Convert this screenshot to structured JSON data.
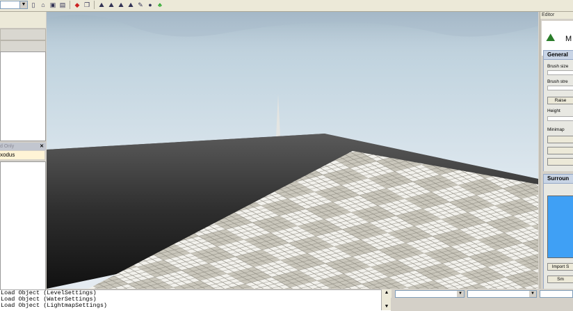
{
  "toolbar": {
    "combo_value": "",
    "icons": [
      "new-file-icon",
      "open-folder-icon",
      "save-icon",
      "save-all-icon",
      "red-tool-icon",
      "copy-icon",
      "terrain-tool-1-icon",
      "terrain-tool-2-icon",
      "terrain-tool-3-icon",
      "terrain-tool-4-icon",
      "paint-tool-icon",
      "object-tool-icon",
      "tree-tool-icon"
    ]
  },
  "left_panel": {
    "section_header": "d Only",
    "selected_item": "xodus"
  },
  "editor": {
    "panel_title": "Editor",
    "header_text": "M",
    "general_label": "General",
    "brush_size_label": "Brush size",
    "brush_strength_label": "Brush stre",
    "raise_label": "Raise",
    "height_label": "Height",
    "minimap_label": "Minimap",
    "surround_label": "Surroun",
    "import_label": "Import S",
    "sm_label": "Sm"
  },
  "console": {
    "lines": [
      "Load Object (LevelSettings)",
      "Load Object (WaterSettings)",
      "Load Object (LightmapSettings)"
    ]
  },
  "colors": {
    "sky_top": "#b9ccd9",
    "sky_bottom": "#e1eaf1",
    "ground_dark": "#3a3a3a",
    "checker_light": "#f2f1ec",
    "checker_dark": "#c9c6bb",
    "minimap_blue": "#3fa0f5"
  }
}
